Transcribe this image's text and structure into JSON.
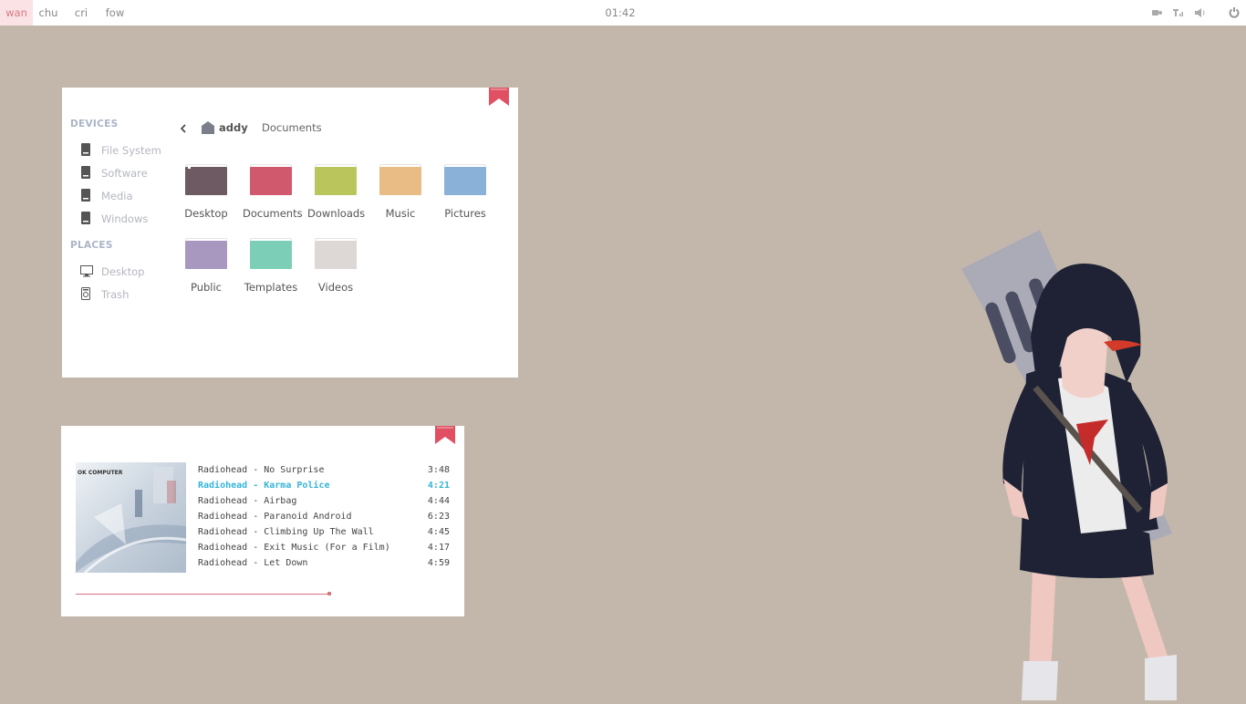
{
  "topbar": {
    "workspaces": [
      {
        "label": "wan",
        "active": true
      },
      {
        "label": "chu",
        "active": false
      },
      {
        "label": "cri",
        "active": false
      },
      {
        "label": "fow",
        "active": false
      }
    ],
    "clock": "01:42",
    "tray_icons": [
      "network-icon",
      "signal-icon",
      "volume-icon",
      "power-icon"
    ]
  },
  "file_manager": {
    "sidebar": {
      "devices_heading": "DEVICES",
      "devices": [
        "File System",
        "Software",
        "Media",
        "Windows"
      ],
      "places_heading": "PLACES",
      "places": [
        "Desktop",
        "Trash"
      ]
    },
    "breadcrumb": {
      "home": "addy",
      "current": "Documents"
    },
    "folders": [
      {
        "label": "Desktop",
        "color": "#6e5a62"
      },
      {
        "label": "Documents",
        "color": "#d0596d"
      },
      {
        "label": "Downloads",
        "color": "#bac65b"
      },
      {
        "label": "Music",
        "color": "#e8bc84"
      },
      {
        "label": "Pictures",
        "color": "#8ab2d9"
      },
      {
        "label": "Public",
        "color": "#a898c0"
      },
      {
        "label": "Templates",
        "color": "#7ccfb6"
      },
      {
        "label": "Videos",
        "color": "#ddd7d6"
      }
    ]
  },
  "music_player": {
    "album_title": "OK COMPUTER",
    "tracks": [
      {
        "title": "Radiohead - No Surprise",
        "duration": "3:48",
        "active": false
      },
      {
        "title": "Radiohead - Karma Police",
        "duration": "4:21",
        "active": true
      },
      {
        "title": "Radiohead - Airbag",
        "duration": "4:44",
        "active": false
      },
      {
        "title": "Radiohead - Paranoid Android",
        "duration": "6:23",
        "active": false
      },
      {
        "title": "Radiohead - Climbing Up The Wall",
        "duration": "4:45",
        "active": false
      },
      {
        "title": "Radiohead - Exit Music (For a Film)",
        "duration": "4:17",
        "active": false
      },
      {
        "title": "Radiohead - Let Down",
        "duration": "4:59",
        "active": false
      }
    ],
    "progress": 0.43
  },
  "colors": {
    "background": "#c3b7ab",
    "accent_red": "#e05062",
    "active_track": "#35b5d9"
  }
}
